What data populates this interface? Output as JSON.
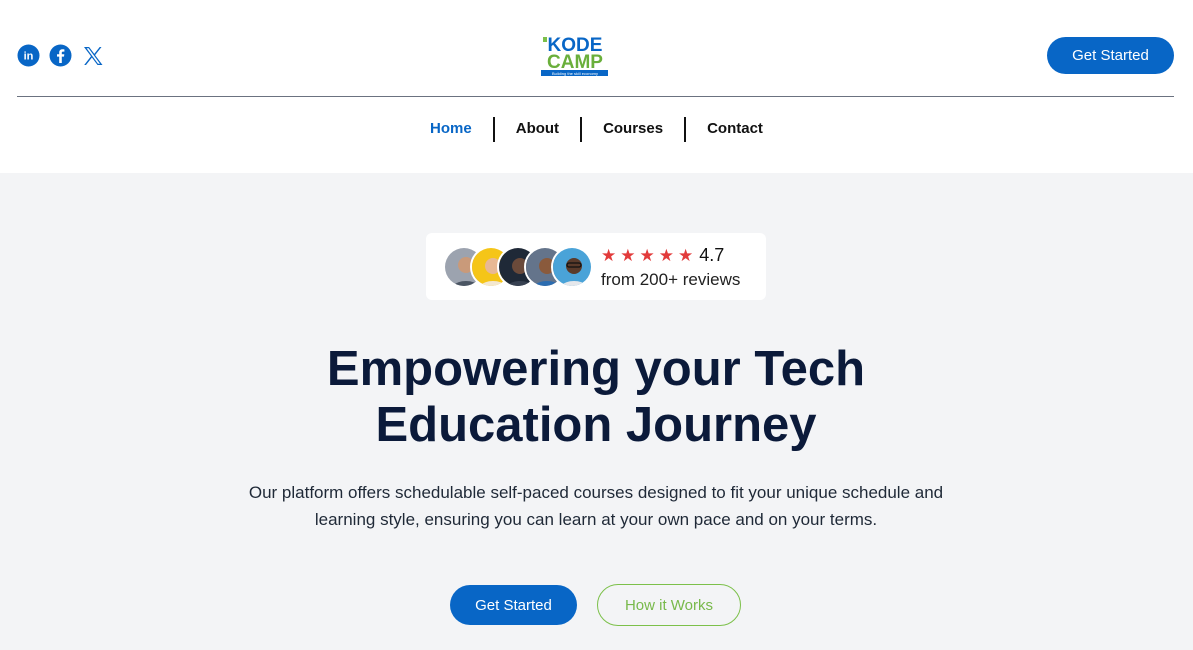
{
  "header": {
    "social": [
      {
        "icon": "linkedin-icon",
        "label": "in"
      },
      {
        "icon": "facebook-icon",
        "label": "f"
      },
      {
        "icon": "x-twitter-icon",
        "label": "X"
      }
    ],
    "logo": {
      "line1": "KODE",
      "line2": "CAMP",
      "tagline": "Building the skill economy"
    },
    "cta_label": "Get Started"
  },
  "nav": {
    "items": [
      {
        "label": "Home",
        "active": true
      },
      {
        "label": "About",
        "active": false
      },
      {
        "label": "Courses",
        "active": false
      },
      {
        "label": "Contact",
        "active": false
      }
    ]
  },
  "hero": {
    "reviews": {
      "stars": 5,
      "rating": "4.7",
      "text": "from 200+ reviews"
    },
    "title_line1": "Empowering your Tech",
    "title_line2": "Education Journey",
    "description": "Our platform offers schedulable self-paced courses designed to fit your unique schedule and learning style, ensuring you can learn at your own pace and on your terms.",
    "primary_cta": "Get Started",
    "secondary_cta": "How it Works"
  },
  "colors": {
    "brand_blue": "#0866c6",
    "accent_green": "#7cc04a",
    "headline": "#0b1a3a",
    "hero_bg": "#f3f4f6",
    "star": "#e23b3b"
  }
}
